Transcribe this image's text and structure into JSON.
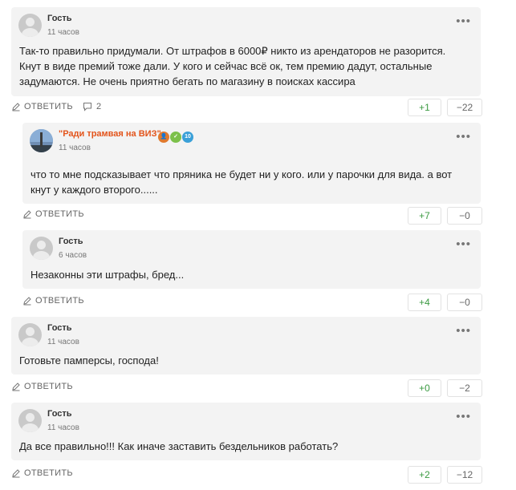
{
  "actions": {
    "reply_label": "ОТВЕТИТЬ"
  },
  "colors": {
    "vote_up": "#3b9a42",
    "author_highlight": "#e3541b",
    "card_bg": "#f3f3f3"
  },
  "comments": [
    {
      "author": "Гость",
      "time": "11 часов",
      "text": "Так-то правильно придумали. От штрафов в 6000₽ никто из арендаторов не разорится. Кнут в виде премий тоже дали. У кого и сейчас всё ок, тем премию дадут, остальные задумаются. Не очень приятно бегать по магазину в поисках кассира",
      "replies_count": "2",
      "votes_up": "+1",
      "votes_down": "−22"
    },
    {
      "author": "\"Ради трамвая на ВИЗ\"",
      "time": "11 часов",
      "text": "что то мне подсказывает что пряника не будет ни у кого. или у парочки для вида. а вот кнут у каждого второго......",
      "badges": [
        "user-badge-icon",
        "check-badge-icon",
        "level-badge-icon"
      ],
      "badge_level": "10",
      "votes_up": "+7",
      "votes_down": "−0"
    },
    {
      "author": "Гость",
      "time": "6 часов",
      "text": "Незаконны эти штрафы, бред...",
      "votes_up": "+4",
      "votes_down": "−0"
    },
    {
      "author": "Гость",
      "time": "11 часов",
      "text": "Готовьте памперсы, господа!",
      "votes_up": "+0",
      "votes_down": "−2"
    },
    {
      "author": "Гость",
      "time": "11 часов",
      "text": "Да все правильно!!! Как иначе заставить бездельников работать?",
      "votes_up": "+2",
      "votes_down": "−12"
    }
  ]
}
